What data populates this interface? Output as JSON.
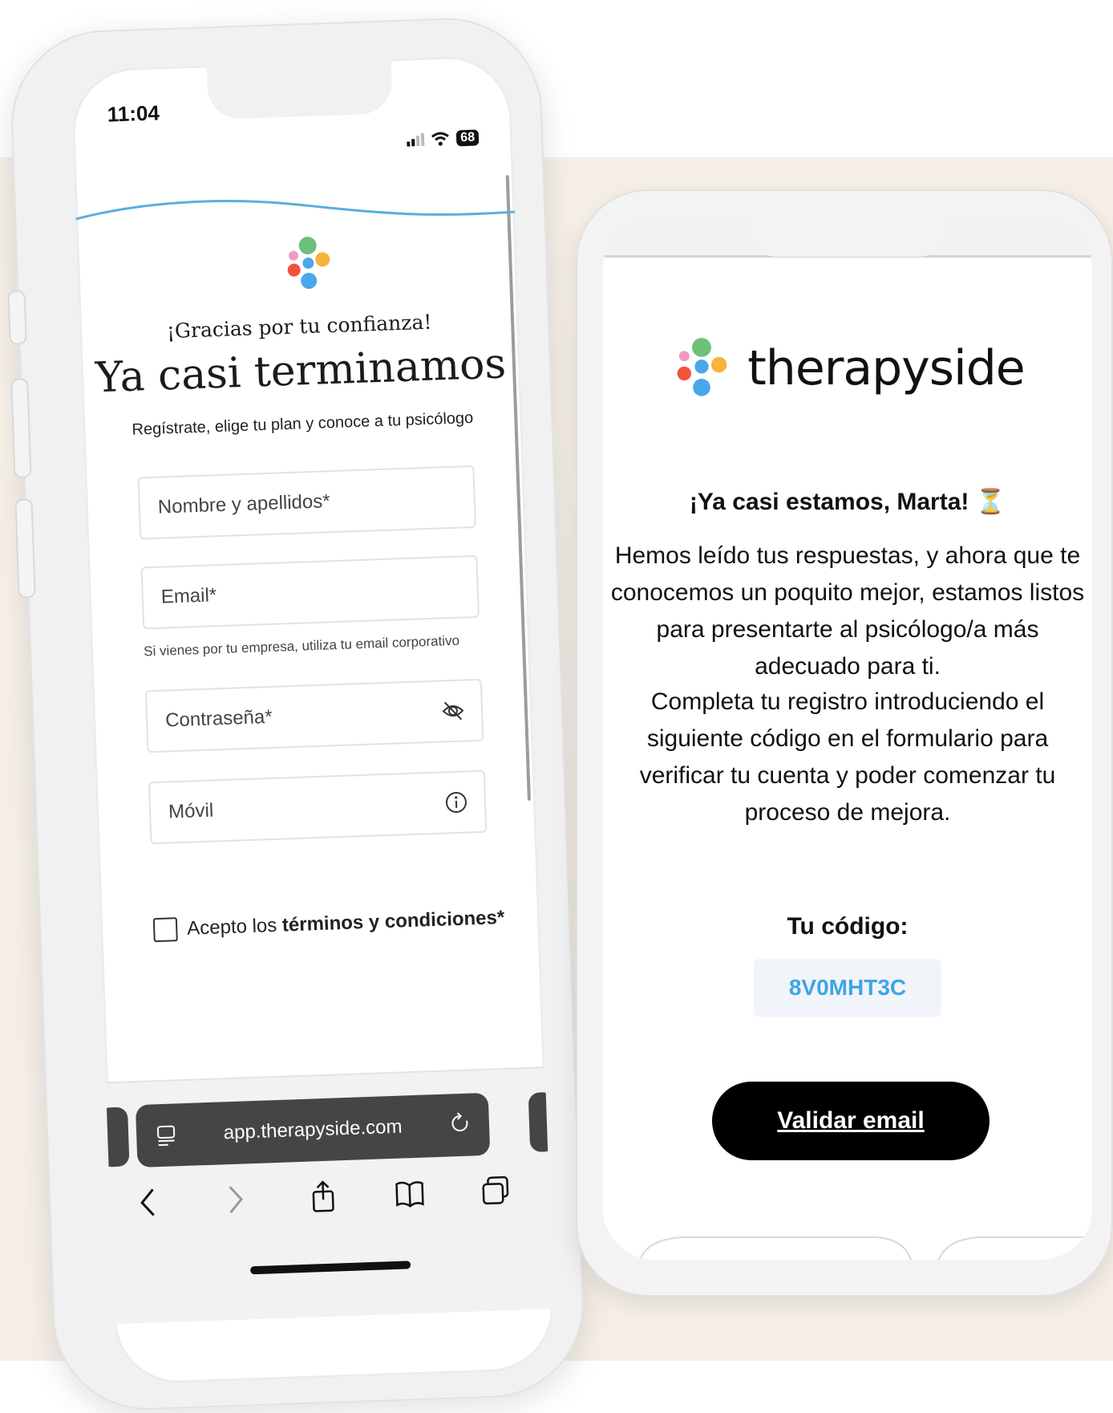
{
  "left_phone": {
    "status": {
      "time": "11:04",
      "battery": "68"
    },
    "thanks": "¡Gracias por tu confianza!",
    "headline": "Ya casi terminamos",
    "subhead": "Regístrate, elige tu plan y conoce a tu psicólogo",
    "fields": {
      "name_placeholder": "Nombre y apellidos*",
      "email_placeholder": "Email*",
      "email_helper": "Si vienes por tu empresa, utiliza tu email corporativo",
      "password_placeholder": "Contraseña*",
      "phone_placeholder": "Móvil"
    },
    "terms": {
      "prefix": "Acepto los ",
      "link": "términos y condiciones*"
    },
    "browser": {
      "url": "app.therapyside.com"
    }
  },
  "right_phone": {
    "brand": "therapyside",
    "greeting": "¡Ya casi estamos, Marta! ⏳",
    "paragraph1": "Hemos leído tus respuestas, y ahora que te conocemos un poquito mejor, estamos listos para presentarte al psicólogo/a más adecuado para ti.",
    "paragraph2": "Completa tu registro introduciendo el siguiente código en el formulario para verificar tu cuenta y poder comenzar tu proceso de mejora.",
    "code_label": "Tu código:",
    "code": "8V0MHT3C",
    "button": "Validar email"
  },
  "colors": {
    "background_band": "#f5efe8",
    "code_text": "#3ea5e8",
    "button_bg": "#000000",
    "logo_green": "#6cc07a",
    "logo_pink": "#f29ac4",
    "logo_orange": "#f7b33b",
    "logo_red": "#f0533c",
    "logo_blue": "#4aa8e8"
  }
}
